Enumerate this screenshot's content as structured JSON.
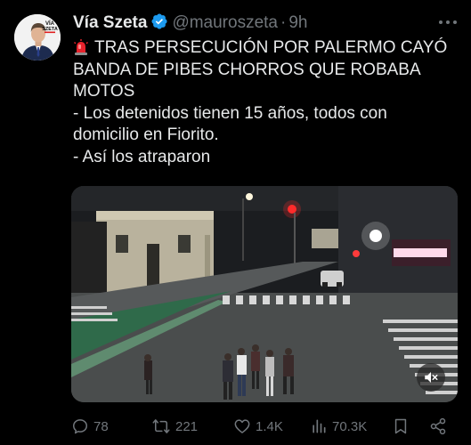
{
  "author": {
    "display_name": "Vía Szeta",
    "handle": "@mauroszeta",
    "time": "9h",
    "avatar_text": [
      "VÍA",
      "SZETA"
    ]
  },
  "tweet": {
    "lines": [
      "TRAS PERSECUCIÓN POR PALERMO CAYÓ",
      "BANDA DE PIBES CHORROS QUE ROBABA",
      "MOTOS",
      "- Los detenidos tienen 15 años, todos con",
      "domicilio en Fiorito.",
      "- Así los atraparon"
    ],
    "leading_icon": "police-siren-icon"
  },
  "media": {
    "type": "video",
    "muted": true
  },
  "metrics": {
    "replies": "78",
    "reposts": "221",
    "likes": "1.4K",
    "views": "70.3K"
  },
  "colors": {
    "verified": "#1d9bf0",
    "muted_text": "#71767b",
    "text": "#e7e9ea"
  }
}
